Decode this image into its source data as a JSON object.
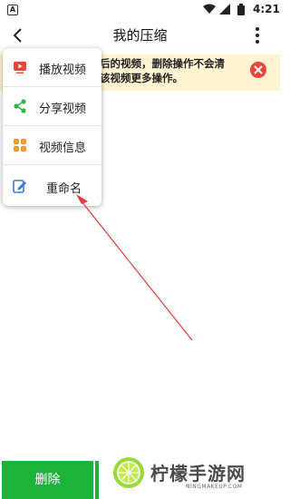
{
  "status_bar": {
    "notification_letter": "A",
    "time": "4:21"
  },
  "header": {
    "title": "我的压缩"
  },
  "notice": {
    "text": "后的视频，删除操作不会清\n该视频更多操作。"
  },
  "menu": {
    "items": [
      {
        "label": "播放视频",
        "icon": "play-icon",
        "color": "#e8453c"
      },
      {
        "label": "分享视频",
        "icon": "share-icon",
        "color": "#2fb34a"
      },
      {
        "label": "视频信息",
        "icon": "info-grid-icon",
        "color": "#f29b2c"
      },
      {
        "label": "重命名",
        "icon": "edit-icon",
        "color": "#3a7bd5"
      }
    ]
  },
  "bottom": {
    "delete_label": "删除"
  },
  "watermark": {
    "title": "柠檬手游网",
    "url": "NINGMAKEUP.COM"
  },
  "colors": {
    "accent_green": "#1bb33a",
    "notice_bg": "#fff3d1",
    "close_red": "#e8453c",
    "arrow_red": "#e53935"
  }
}
